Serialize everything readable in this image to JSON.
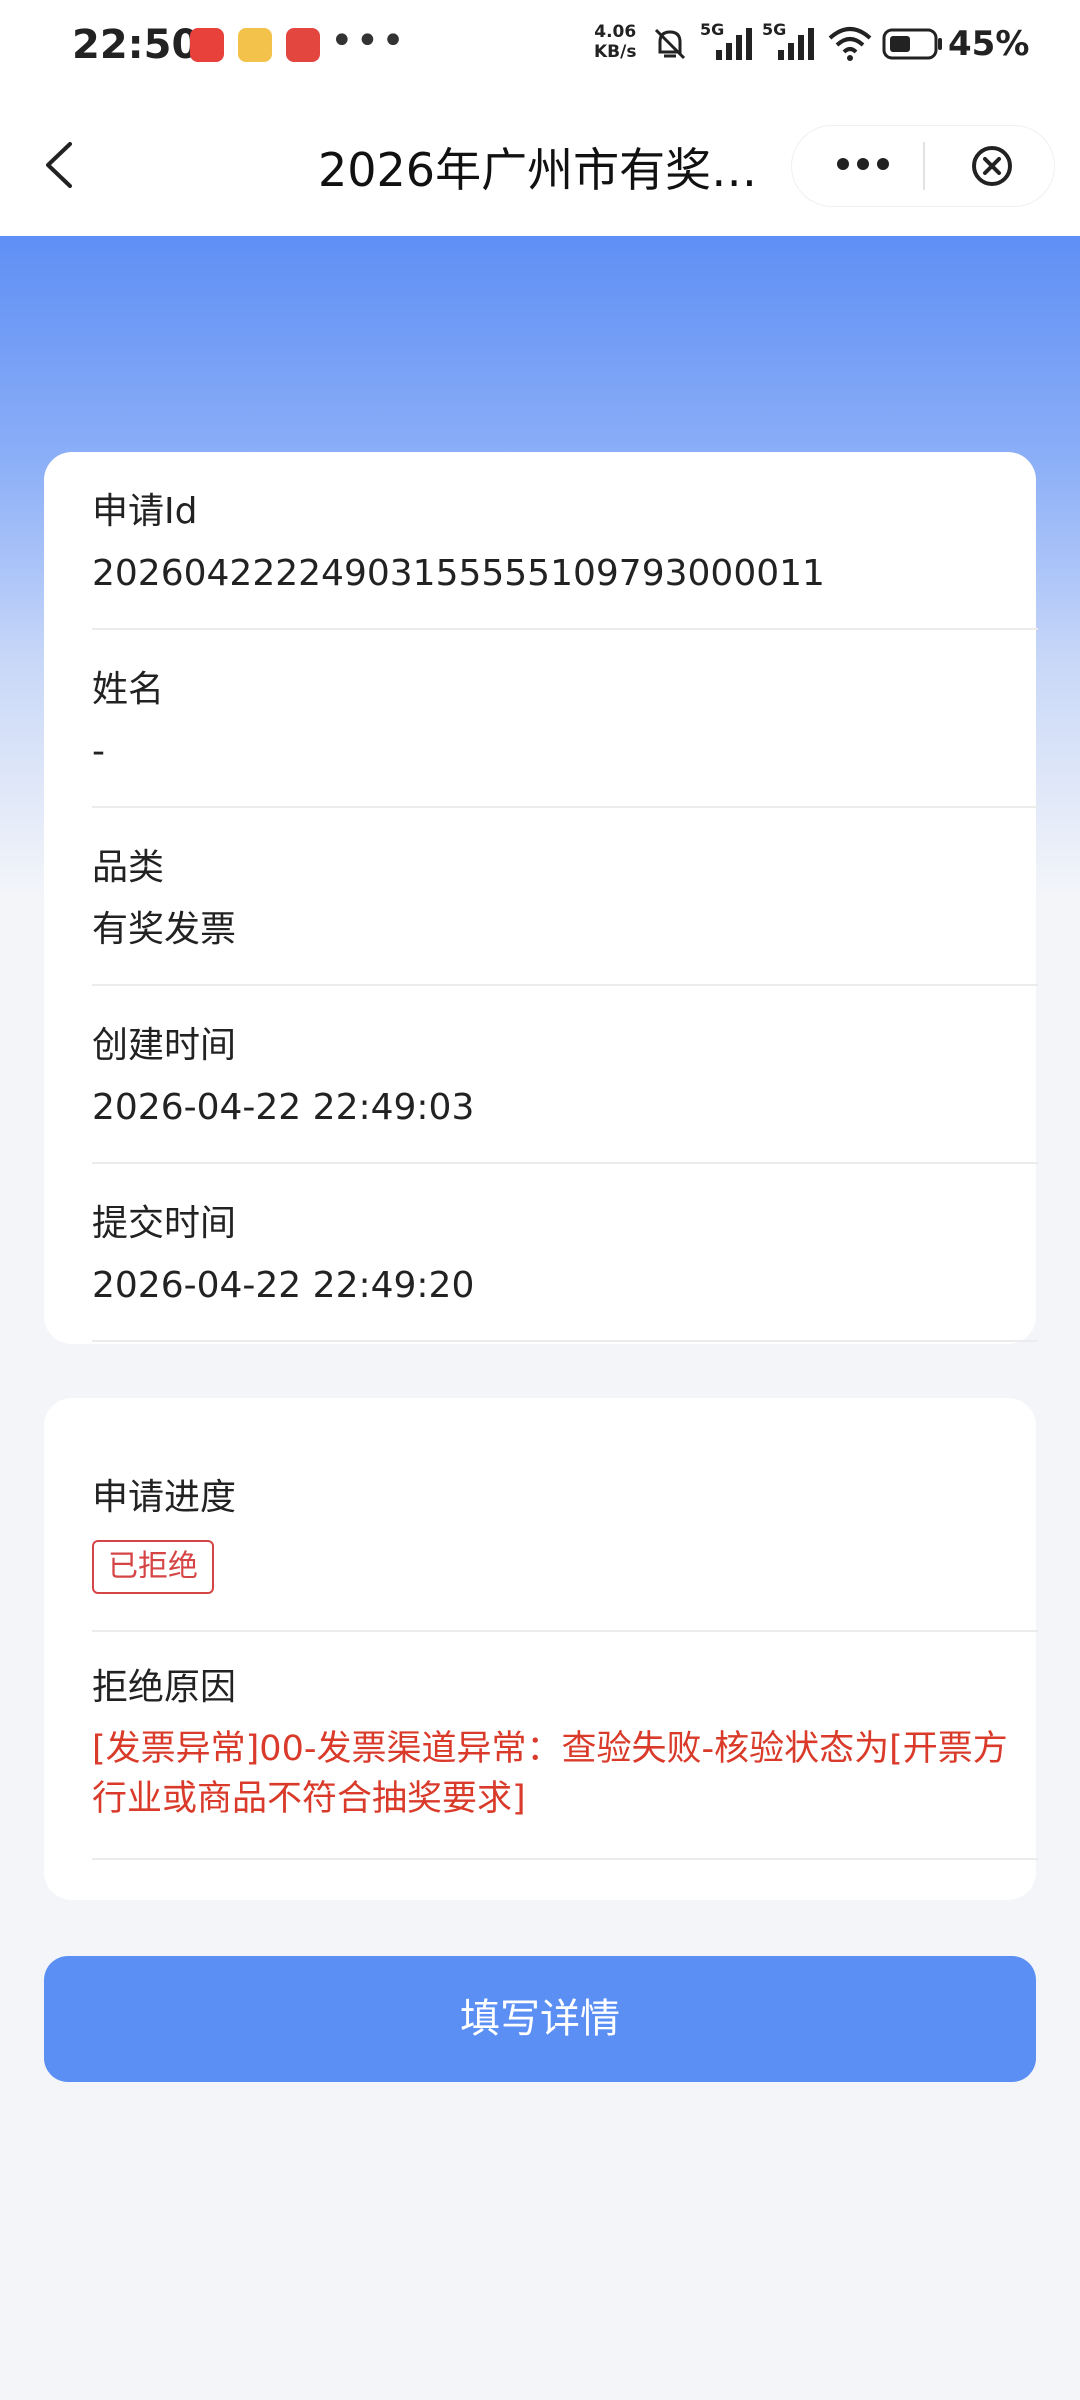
{
  "status_bar": {
    "time": "22:50",
    "network_speed_value": "4.06",
    "network_speed_unit": "KB/s",
    "signal1_label": "5G",
    "signal2_label": "5G",
    "battery": "45%",
    "more_icon": "•••"
  },
  "nav": {
    "title": "2026年广州市有奖…"
  },
  "details": {
    "apply_id_label": "申请Id",
    "apply_id_value": "20260422224903155555109793000011",
    "name_label": "姓名",
    "name_value": "-",
    "category_label": "品类",
    "category_value": "有奖发票",
    "created_label": "创建时间",
    "created_value": "2026-04-22 22:49:03",
    "submitted_label": "提交时间",
    "submitted_value": "2026-04-22 22:49:20"
  },
  "progress": {
    "progress_label": "申请进度",
    "status_badge": "已拒绝",
    "reason_label": "拒绝原因",
    "reason_text": "[发票异常]00-发票渠道异常：查验失败-核验状态为[开票方行业或商品不符合抽奖要求]"
  },
  "actions": {
    "submit_label": "填写详情"
  },
  "colors": {
    "accent": "#5b8ff4",
    "danger": "#d64545"
  }
}
